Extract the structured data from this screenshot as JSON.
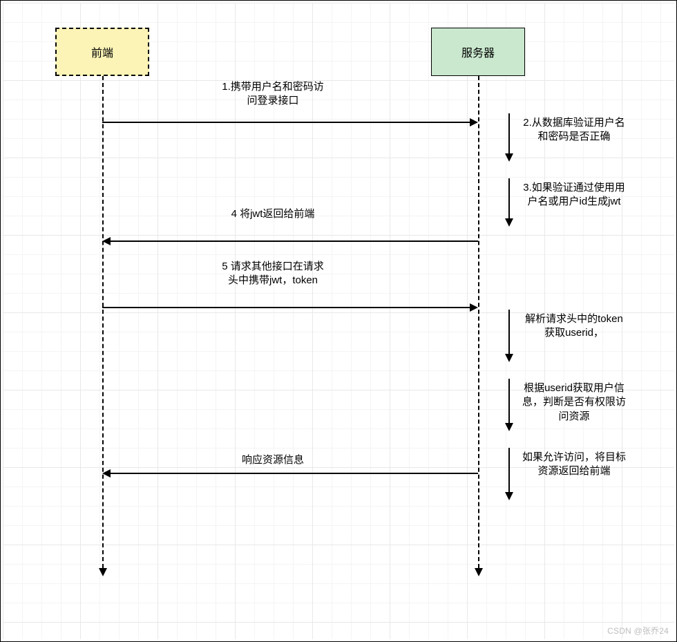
{
  "actors": {
    "frontend": "前端",
    "server": "服务器"
  },
  "messages": {
    "m1": "1.携带用户名和密码访问登录接口",
    "m4": "4 将jwt返回给前端",
    "m5": "5 请求其他接口在请求头中携带jwt，token",
    "m_resp": "响应资源信息"
  },
  "server_steps": {
    "s2": "2.从数据库验证用户名和密码是否正确",
    "s3": "3.如果验证通过使用用户名或用户id生成jwt",
    "s_parse": "解析请求头中的token获取userid，",
    "s_auth": "根据userid获取用户信息，判断是否有权限访问资源",
    "s_allow": "如果允许访问，将目标资源返回给前端"
  },
  "watermark": "CSDN @张乔24"
}
